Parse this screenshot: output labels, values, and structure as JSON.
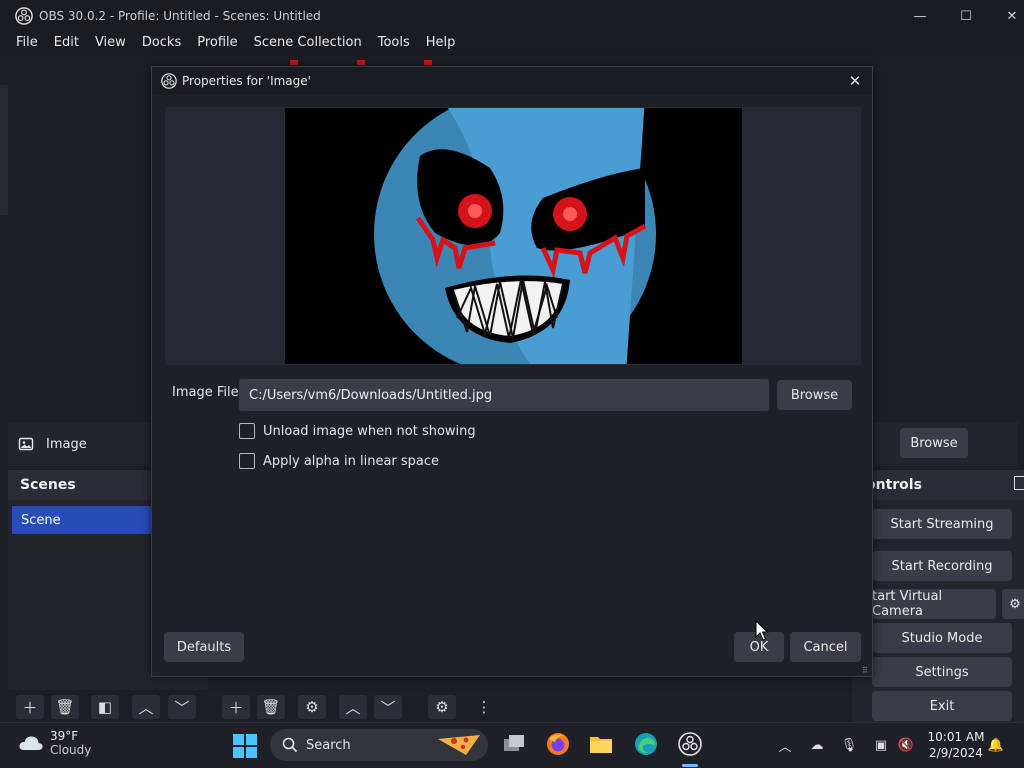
{
  "window": {
    "title": "OBS 30.0.2 - Profile: Untitled - Scenes: Untitled",
    "minimize_glyph": "—",
    "maximize_glyph": "☐",
    "close_glyph": "✕"
  },
  "menu": {
    "items": [
      "File",
      "Edit",
      "View",
      "Docks",
      "Profile",
      "Scene Collection",
      "Tools",
      "Help"
    ]
  },
  "sources": {
    "selected_label": "Image",
    "browse_label": "Browse"
  },
  "scenes_dock": {
    "header": "Scenes",
    "items": [
      "Scene"
    ]
  },
  "controls_dock": {
    "header": "ontrols",
    "start_streaming": "Start Streaming",
    "start_recording": "Start Recording",
    "virtual_camera": "tart Virtual Camera",
    "studio_mode": "Studio Mode",
    "settings": "Settings",
    "exit": "Exit"
  },
  "dialog": {
    "title": "Properties for 'Image'",
    "image_file_label": "Image File",
    "image_file_value": "C:/Users/vm6/Downloads/Untitled.jpg",
    "browse_label": "Browse",
    "unload_label": "Unload image when not showing",
    "unload_checked": false,
    "alpha_label": "Apply alpha in linear space",
    "alpha_checked": false,
    "defaults_label": "Defaults",
    "ok_label": "OK",
    "cancel_label": "Cancel"
  },
  "taskbar": {
    "weather_temp": "39°F",
    "weather_condition": "Cloudy",
    "search_label": "Search",
    "time": "10:01 AM",
    "date": "2/9/2024"
  },
  "colors": {
    "accent_blue": "#284cb8",
    "dialog_bg": "#1f2129",
    "button_bg": "#3a3d48",
    "marker_red": "#d01a1a"
  }
}
